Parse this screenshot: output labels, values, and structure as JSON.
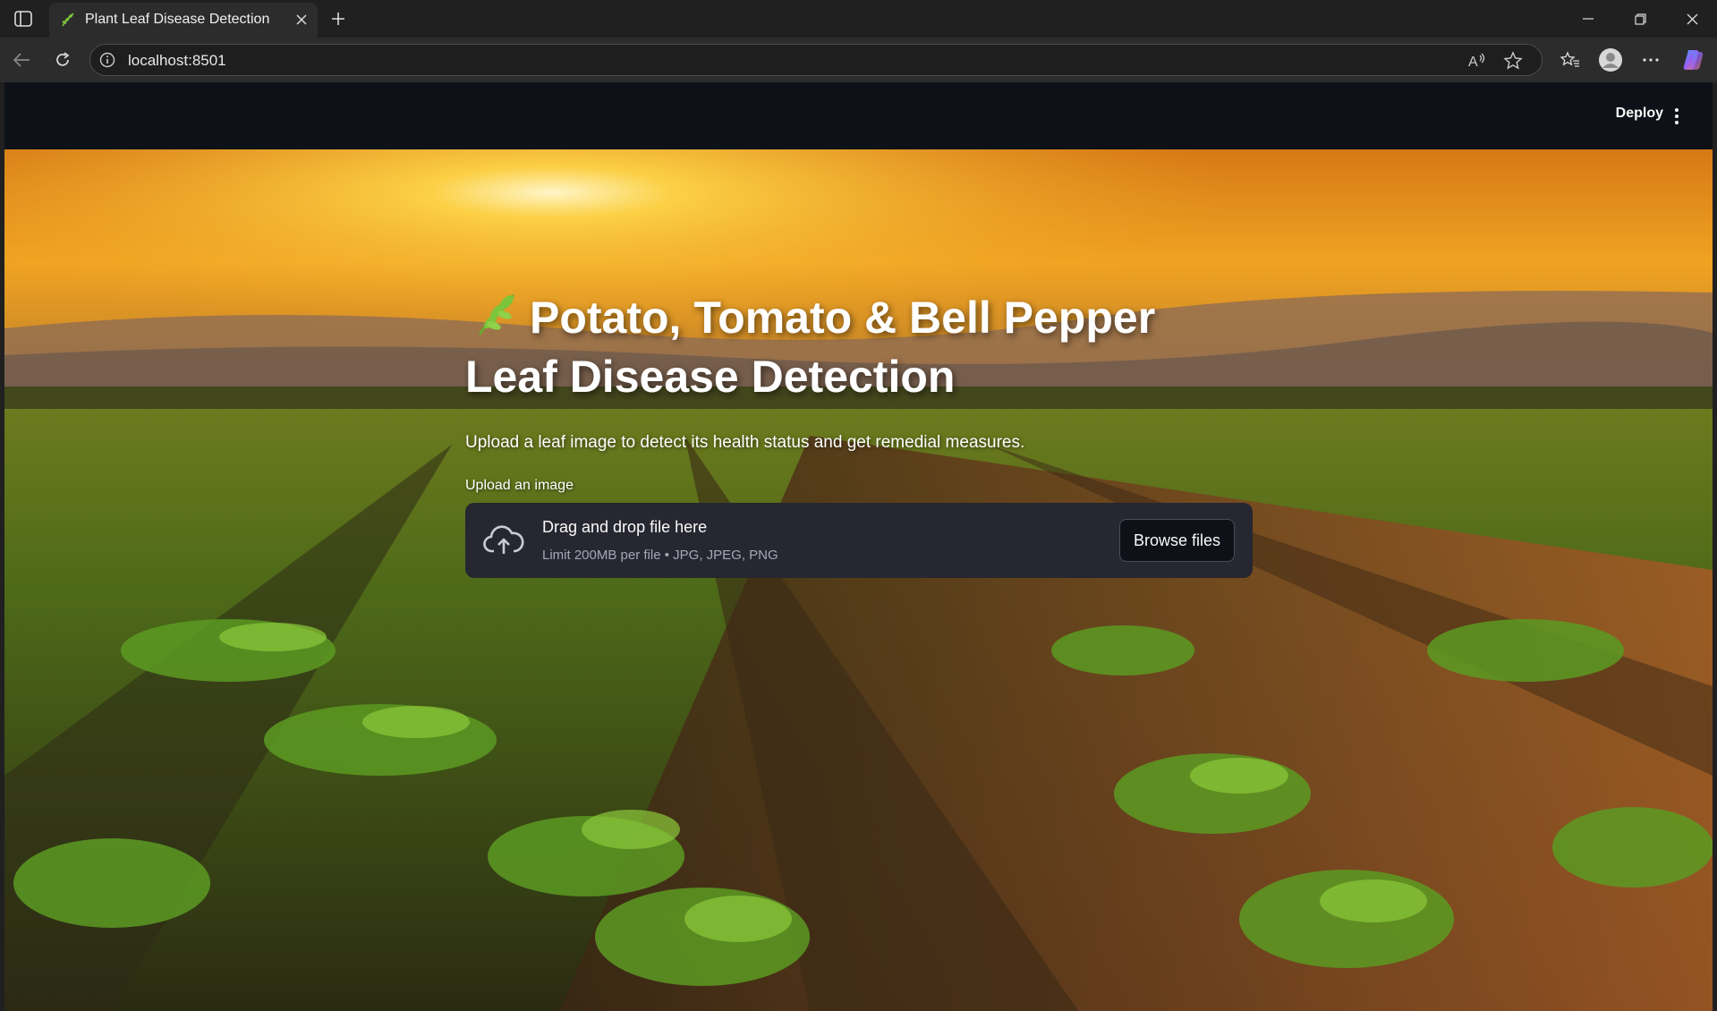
{
  "browser": {
    "tab_title": "Plant Leaf Disease Detection",
    "url": "localhost:8501"
  },
  "app": {
    "deploy_label": "Deploy",
    "title_line1": "Potato, Tomato & Bell Pepper",
    "title_line2": "Leaf Disease Detection",
    "subtitle": "Upload a leaf image to detect its health status and get remedial measures.",
    "uploader": {
      "label": "Upload an image",
      "drag_text": "Drag and drop file here",
      "limit_text": "Limit 200MB per file • JPG, JPEG, PNG",
      "browse_label": "Browse files"
    }
  },
  "colors": {
    "header_bg": "#0e1117",
    "dropzone_bg": "#262730",
    "browser_chrome": "#202020"
  }
}
